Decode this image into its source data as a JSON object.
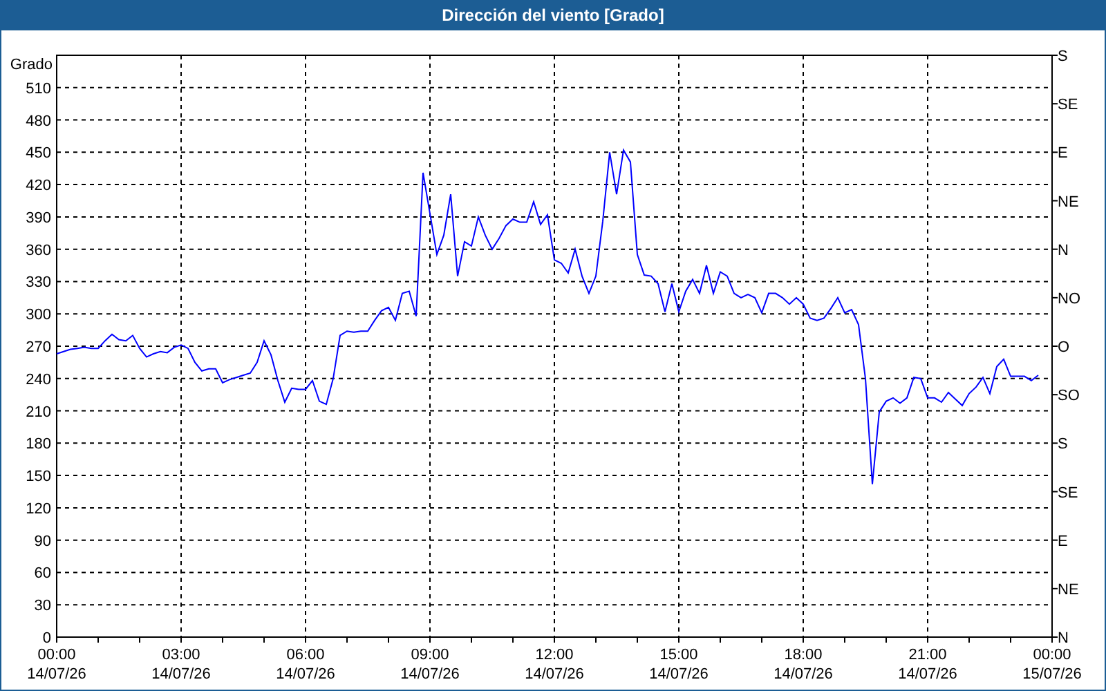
{
  "window": {
    "title": "Dirección del viento [Grado]"
  },
  "chart": {
    "chart_data": {
      "type": "line",
      "ylabel": "Grado",
      "categories": [
        "00:00\n14/07/26",
        null,
        null,
        null,
        null,
        null,
        null,
        null,
        null,
        null,
        null,
        null,
        null,
        null,
        null,
        null,
        null,
        null,
        "03:00\n14/07/26",
        null,
        null,
        null,
        null,
        null,
        null,
        null,
        null,
        null,
        null,
        null,
        null,
        null,
        null,
        null,
        null,
        null,
        "06:00\n14/07/26",
        null,
        null,
        null,
        null,
        null,
        null,
        null,
        null,
        null,
        null,
        null,
        null,
        null,
        null,
        null,
        null,
        null,
        "09:00\n14/07/26",
        null,
        null,
        null,
        null,
        null,
        null,
        null,
        null,
        null,
        null,
        null,
        null,
        null,
        null,
        null,
        null,
        null,
        "12:00\n14/07/26",
        null,
        null,
        null,
        null,
        null,
        null,
        null,
        null,
        null,
        null,
        null,
        null,
        null,
        null,
        null,
        null,
        null,
        "15:00\n14/07/26",
        null,
        null,
        null,
        null,
        null,
        null,
        null,
        null,
        null,
        null,
        null,
        null,
        null,
        null,
        null,
        null,
        null,
        "18:00\n14/07/26",
        null,
        null,
        null,
        null,
        null,
        null,
        null,
        null,
        null,
        null,
        null,
        null,
        null,
        null,
        null,
        null,
        null,
        "21:00\n14/07/26",
        null,
        null,
        null,
        null,
        null,
        null,
        null,
        null,
        null,
        null,
        null,
        null,
        null,
        null,
        null,
        null,
        null,
        "00:00\n15/07/26"
      ],
      "series": [
        {
          "color": "#0000ff",
          "values": [
            263,
            265,
            267,
            268,
            269,
            268,
            268,
            275,
            281,
            276,
            275,
            280,
            268,
            260,
            263,
            265,
            264,
            269,
            271,
            268,
            255,
            247,
            249,
            249,
            236,
            239,
            241,
            243,
            245,
            255,
            275,
            262,
            238,
            218,
            231,
            230,
            230,
            238,
            219,
            216,
            240,
            280,
            284,
            283,
            284,
            284,
            294,
            303,
            306,
            294,
            319,
            321,
            298,
            431,
            393,
            355,
            373,
            411,
            335,
            367,
            363,
            390,
            373,
            360,
            370,
            382,
            388,
            385,
            385,
            404,
            383,
            392,
            350,
            347,
            338,
            360,
            335,
            319,
            335,
            386,
            450,
            411,
            452,
            441,
            355,
            336,
            335,
            328,
            302,
            328,
            302,
            321,
            332,
            319,
            345,
            319,
            339,
            335,
            319,
            315,
            318,
            315,
            301,
            319,
            319,
            315,
            309,
            315,
            309,
            296,
            294,
            296,
            305,
            315,
            301,
            304,
            290,
            240,
            142,
            209,
            219,
            222,
            217,
            222,
            241,
            240,
            222,
            222,
            218,
            227,
            221,
            215,
            226,
            232,
            241,
            226,
            251,
            258,
            242,
            242,
            242,
            238,
            243,
            null,
            null
          ]
        }
      ],
      "ylim": [
        0,
        540
      ],
      "grid": true,
      "yticks": [
        0,
        30,
        60,
        90,
        120,
        150,
        180,
        210,
        240,
        270,
        300,
        330,
        360,
        390,
        420,
        450,
        480,
        510
      ]
    },
    "compass_axis": [
      "S",
      "SE",
      "E",
      "NE",
      "N",
      "NO",
      "O",
      "SO",
      "S",
      "SE",
      "E",
      "NE",
      "N"
    ]
  }
}
